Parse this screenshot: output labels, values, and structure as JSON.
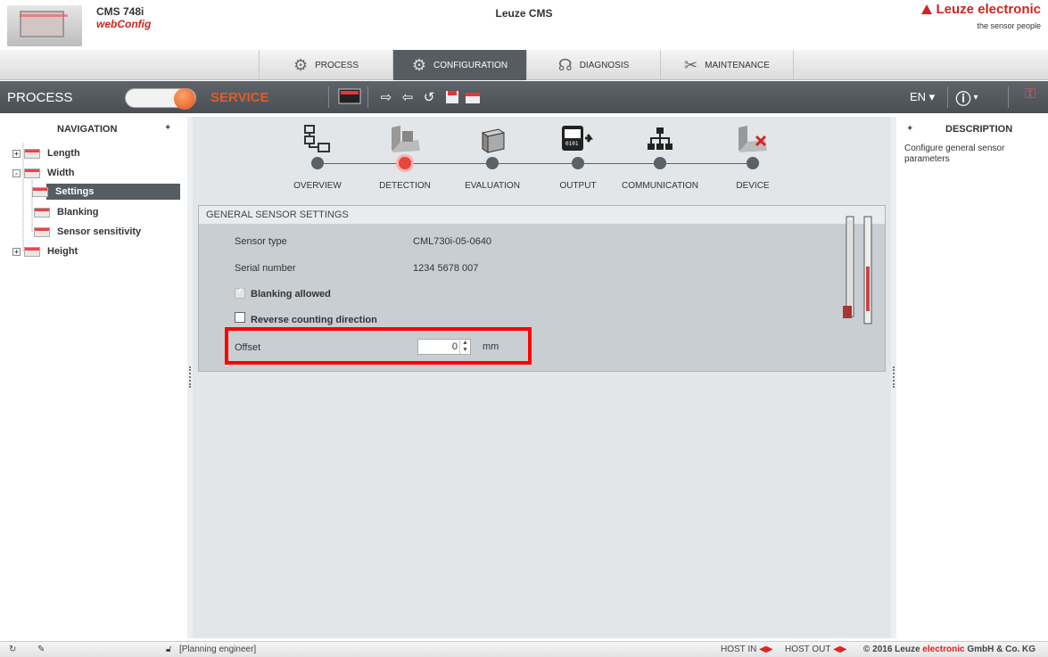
{
  "header": {
    "app_title": "CMS 748i",
    "app_subtitle": "webConfig",
    "center_title": "Leuze CMS",
    "brand": "Leuze electronic",
    "tagline": "the sensor people"
  },
  "tabs": [
    {
      "label": "PROCESS",
      "icon": "gears-icon",
      "active": false
    },
    {
      "label": "CONFIGURATION",
      "icon": "configuration-icon",
      "active": true
    },
    {
      "label": "DIAGNOSIS",
      "icon": "stethoscope-icon",
      "active": false
    },
    {
      "label": "MAINTENANCE",
      "icon": "tools-icon",
      "active": false
    }
  ],
  "toolbar": {
    "mode_left": "PROCESS",
    "mode_right": "SERVICE",
    "language": "EN",
    "icons": [
      "monitor-icon",
      "upload-icon",
      "download-icon",
      "undo-icon",
      "save-icon",
      "save-as-icon",
      "info-icon",
      "login-icon"
    ]
  },
  "navigation": {
    "title": "NAVIGATION",
    "items": [
      {
        "label": "Length",
        "level": 0,
        "expandable": true
      },
      {
        "label": "Width",
        "level": 0,
        "expandable": true
      },
      {
        "label": "Settings",
        "level": 1,
        "selected": true
      },
      {
        "label": "Blanking",
        "level": 1
      },
      {
        "label": "Sensor sensitivity",
        "level": 1
      },
      {
        "label": "Height",
        "level": 0,
        "expandable": true
      }
    ]
  },
  "steps": [
    {
      "label": "OVERVIEW",
      "icon": "overview-icon"
    },
    {
      "label": "DETECTION",
      "icon": "detection-icon",
      "active": true
    },
    {
      "label": "EVALUATION",
      "icon": "evaluation-icon"
    },
    {
      "label": "OUTPUT",
      "icon": "output-icon"
    },
    {
      "label": "COMMUNICATION",
      "icon": "communication-icon"
    },
    {
      "label": "DEVICE",
      "icon": "device-icon"
    }
  ],
  "panel": {
    "title": "GENERAL SENSOR SETTINGS",
    "sensor_type_label": "Sensor type",
    "sensor_type_value": "CML730i-05-0640",
    "serial_label": "Serial number",
    "serial_value": "1234 5678 007",
    "blanking_allowed_label": "Blanking allowed",
    "blanking_allowed_checked": true,
    "reverse_label": "Reverse counting direction",
    "reverse_checked": false,
    "offset_label": "Offset",
    "offset_value": "0",
    "offset_unit": "mm"
  },
  "description": {
    "title": "DESCRIPTION",
    "text": "Configure general sensor parameters"
  },
  "footer": {
    "user": "[Planning engineer]",
    "host_in": "HOST IN",
    "host_out": "HOST OUT",
    "copyright_prefix": "© 2016 Leuze ",
    "copyright_brand": "electronic",
    "copyright_suffix": " GmbH & Co. KG"
  },
  "colors": {
    "brand_red": "#d0231f",
    "toolbar_dark": "#4f555a",
    "service_orange": "#e15b27",
    "highlight": "#ff0000"
  }
}
